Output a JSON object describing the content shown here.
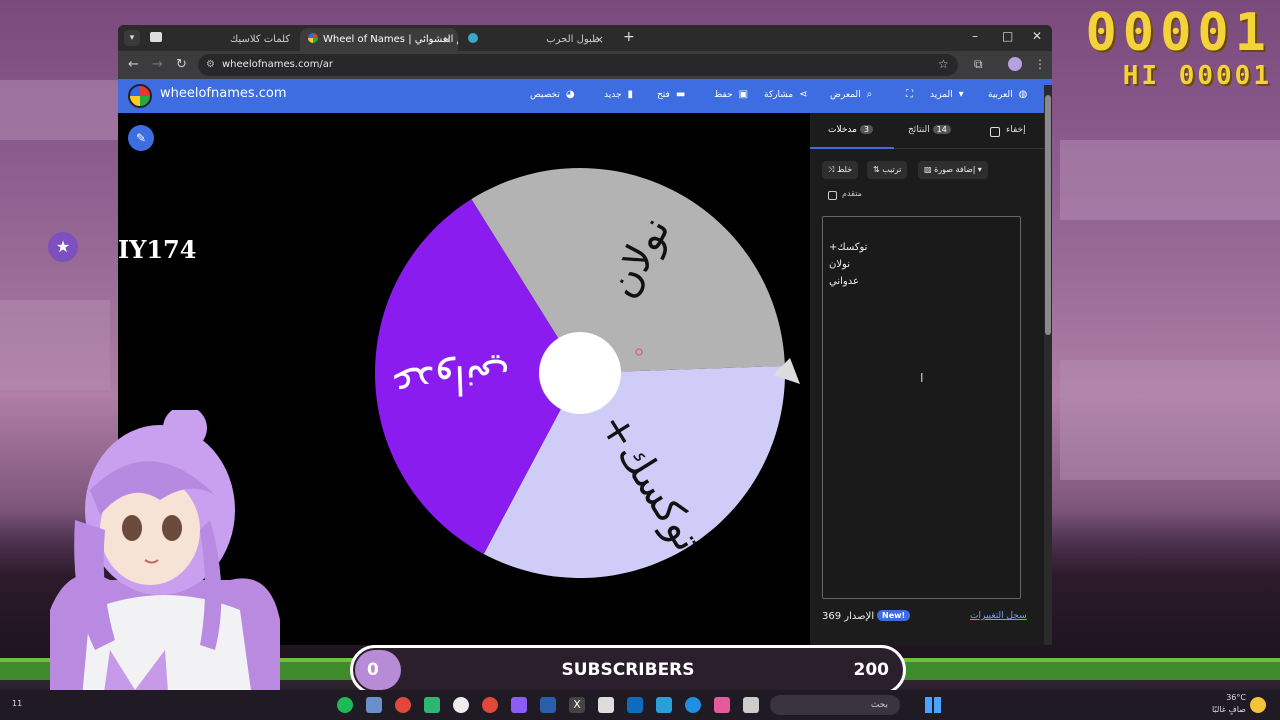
{
  "stream_overlay": {
    "score_top": "00001",
    "score_hi": "HI 00001",
    "room_code": "IY174",
    "subscribers": {
      "current": "0",
      "label": "SUBSCRIBERS",
      "goal": "200",
      "progress": 0.0
    }
  },
  "browser": {
    "tabs": [
      {
        "title": "كلمات كلاسيك",
        "active": false
      },
      {
        "title": "Wheel of Names | مسم العشوائي",
        "active": true
      },
      {
        "title": "طبول الحرب",
        "active": false
      }
    ],
    "url": "wheelofnames.com/ar"
  },
  "site": {
    "title": "wheelofnames.com",
    "menu": [
      {
        "label": "تخصيص",
        "icon": "palette-icon"
      },
      {
        "label": "جديد",
        "icon": "file-icon"
      },
      {
        "label": "فتح",
        "icon": "folder-icon"
      },
      {
        "label": "حفظ",
        "icon": "save-icon"
      },
      {
        "label": "مشاركة",
        "icon": "share-icon"
      },
      {
        "label": "المعرض",
        "icon": "search-icon"
      },
      {
        "label": "",
        "icon": "fullscreen-icon"
      },
      {
        "label": "المزيد",
        "icon": "chevron-down-icon"
      },
      {
        "label": "العربية",
        "icon": "globe-icon"
      }
    ]
  },
  "wheel": {
    "segments": [
      {
        "label": "نولان",
        "color": "#b3b3b3"
      },
      {
        "label": "+توكسك",
        "color": "#cfcdf7"
      },
      {
        "label": "عدواني",
        "color": "#8a1cf0"
      }
    ]
  },
  "panel": {
    "tabs": {
      "entries_label": "مدخلات",
      "entries_count": "3",
      "results_label": "النتائج",
      "results_count": "14",
      "hide_label": "إخفاء"
    },
    "buttons": {
      "shuffle": "خلط",
      "sort": "ترتيب",
      "add_image": "إضافة صورة"
    },
    "advanced_label": "متقدم",
    "entries": [
      "+توكسك",
      "نولان",
      "عدواني"
    ],
    "version": "الإصدار 369",
    "new_badge": "New!",
    "changelog": "سجل التغييرات"
  },
  "taskbar": {
    "search_placeholder": "بحث",
    "temperature": "36°C",
    "weather_text": "صافٍ غالبًا",
    "clock_fragment": "11"
  }
}
